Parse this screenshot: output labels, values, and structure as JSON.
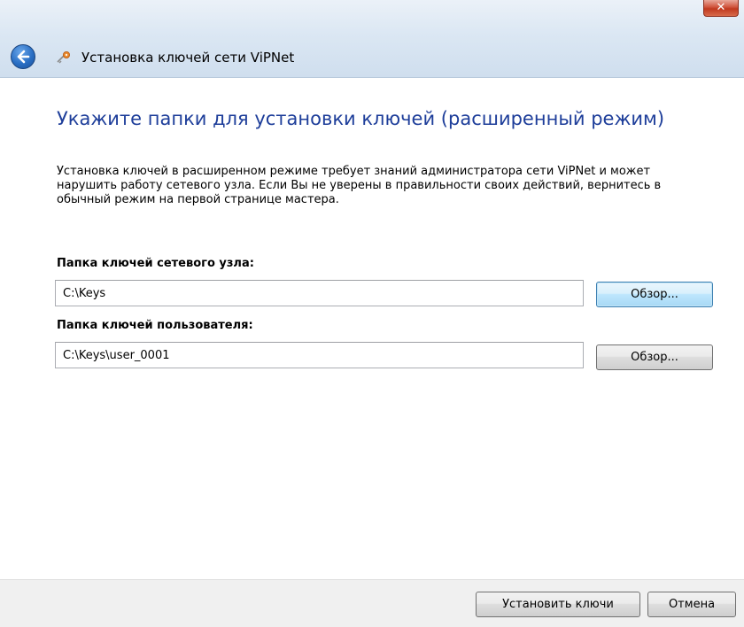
{
  "window": {
    "title": "Установка ключей сети ViPNet",
    "close_label": "✕"
  },
  "page": {
    "heading": "Укажите папки для установки ключей (расширенный режим)",
    "description": "Установка ключей в расширенном режиме требует знаний администратора сети ViPNet и может нарушить работу сетевого узла. Если Вы не уверены в правильности своих действий, вернитесь в обычный режим на первой странице мастера."
  },
  "node_folder": {
    "label": "Папка ключей сетевого узла:",
    "value": "C:\\Keys",
    "browse_label": "Обзор..."
  },
  "user_folder": {
    "label": "Папка ключей пользователя:",
    "value": "C:\\Keys\\user_0001",
    "browse_label": "Обзор..."
  },
  "footer": {
    "install_label": "Установить ключи",
    "cancel_label": "Отмена"
  }
}
